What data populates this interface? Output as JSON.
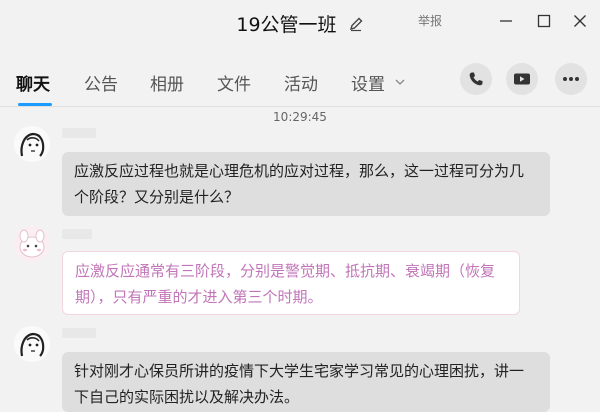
{
  "window": {
    "title": "19公管一班",
    "report": "举报"
  },
  "tabs": [
    "聊天",
    "公告",
    "相册",
    "文件",
    "活动",
    "设置"
  ],
  "chat": {
    "timestamp": "10:29:45",
    "messages": [
      {
        "text": "应激反应过程也就是心理危机的应对过程，那么，这一过程可分为几个阶段？又分别是什么？"
      },
      {
        "text": "应激反应通常有三阶段，分别是警觉期、抵抗期、衰竭期（恢复期），只有严重的才进入第三个时期。",
        "color": "#c275b8"
      },
      {
        "text": "针对刚才心保员所讲的疫情下大学生宅家学习常见的心理困扰，讲一下自己的实际困扰以及解决办法。"
      }
    ]
  },
  "icons": {
    "edit": "edit-icon",
    "phone": "phone-icon",
    "video": "video-icon",
    "more": "more-icon"
  },
  "colors": {
    "accent": "#1e9bff",
    "bubble_gray": "#dedede",
    "pink_text": "#c275b8"
  }
}
